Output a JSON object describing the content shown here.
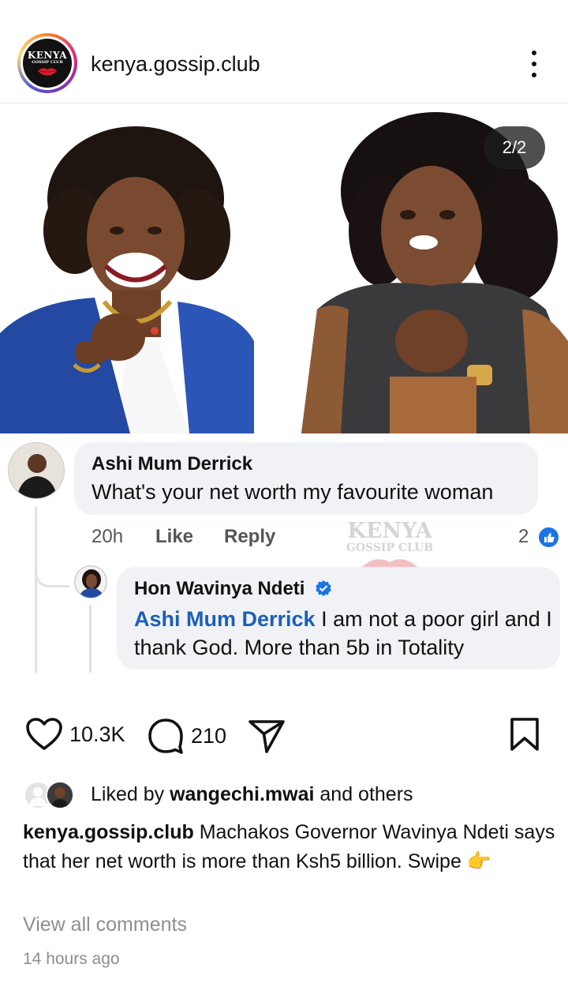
{
  "header": {
    "username": "kenya.gossip.club",
    "logo_title": "KENYA",
    "logo_subtitle": "GOSSIP CLUB"
  },
  "media": {
    "counter": "2/2",
    "watermark_title": "KENYA",
    "watermark_subtitle": "GOSSIP CLUB"
  },
  "comment": {
    "author": "Ashi Mum Derrick",
    "text": "What's your net worth my favourite woman",
    "time": "20h",
    "like_label": "Like",
    "reply_label": "Reply",
    "reaction_count": "2"
  },
  "reply": {
    "author": "Hon Wavinya Ndeti",
    "mention": "Ashi Mum Derrick",
    "text": " I am not  a poor girl and I thank God. More than 5b in Totality"
  },
  "carousel": {
    "current": 2,
    "total": 2
  },
  "actions": {
    "likes_count": "10.3K",
    "comments_count": "210"
  },
  "likes": {
    "prefix": "Liked by ",
    "user": "wangechi.mwai",
    "suffix": " and others"
  },
  "caption": {
    "user": "kenya.gossip.club",
    "text": " Machakos Governor Wavinya Ndeti says that her net worth is more than Ksh5 billion. Swipe ",
    "emoji": "👉"
  },
  "view_comments": "View all comments",
  "timestamp": "14 hours ago",
  "colors": {
    "accent_blue": "#1d8ef5",
    "mention_blue": "#1b5fb8",
    "muted": "#8e8e8e"
  }
}
